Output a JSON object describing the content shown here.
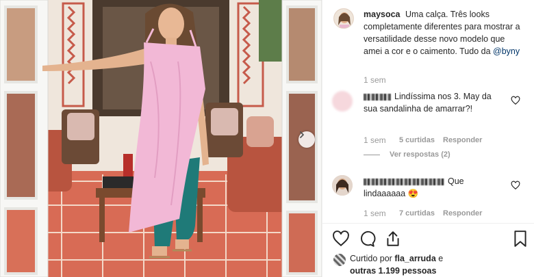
{
  "post": {
    "username": "maysoca",
    "caption": "Uma calça. Três looks completamente diferentes para mostrar a versatilidade desse novo modelo que amei a cor e o caimento. Tudo da",
    "mention": "@byny",
    "time": "1 sem"
  },
  "comments": [
    {
      "text": "Lindíssima nos 3. May da sua sandalinha de amarrar?!",
      "time": "1 sem",
      "likes": "5 curtidas",
      "reply_label": "Responder",
      "view_replies": "Ver respostas (2)"
    },
    {
      "text": "Que lindaaaaaa",
      "emoji": "😍",
      "time": "1 sem",
      "likes": "7 curtidas",
      "reply_label": "Responder"
    }
  ],
  "likes": {
    "prefix": "Curtido por",
    "user": "fla_arruda",
    "suffix": "e",
    "others": "outras 1.199 pessoas"
  },
  "icons": [
    "heart-icon",
    "comment-icon",
    "share-icon",
    "bookmark-icon",
    "chevron-right-icon"
  ],
  "colors": {
    "mention": "#003569",
    "muted": "#999999",
    "dress": "#f2b8d6",
    "pants": "#1f7a78"
  }
}
